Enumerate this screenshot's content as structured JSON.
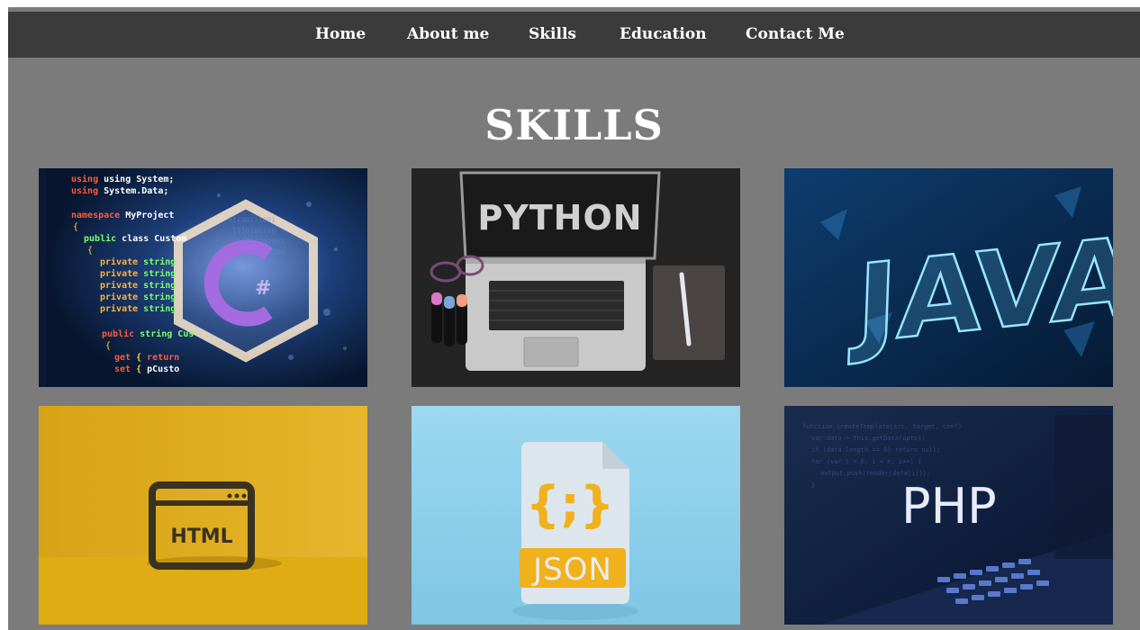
{
  "nav": {
    "items": [
      {
        "label": "Home"
      },
      {
        "label": "About me"
      },
      {
        "label": "Skills"
      },
      {
        "label": "Education"
      },
      {
        "label": "Contact Me"
      }
    ]
  },
  "page": {
    "title": "SKILLS"
  },
  "skills": {
    "csharp": {
      "lines": [
        "using System;",
        "using System.Data;",
        "namespace MyProject",
        "public class Custom",
        "private string",
        "private string",
        "private string",
        "private string",
        "private string",
        "public string Cus",
        "get { return",
        "set { pCusto"
      ]
    },
    "python": {
      "word": "PYTHON"
    },
    "java": {
      "word": "JAVA"
    },
    "html": {
      "word": "HTML"
    },
    "json": {
      "braces": "{;}",
      "word": "JSON"
    },
    "php": {
      "word": "PHP"
    }
  },
  "colors": {
    "page_bg": "#7b7b7b",
    "nav_bg": "#3b3b3b",
    "text": "#ffffff"
  }
}
